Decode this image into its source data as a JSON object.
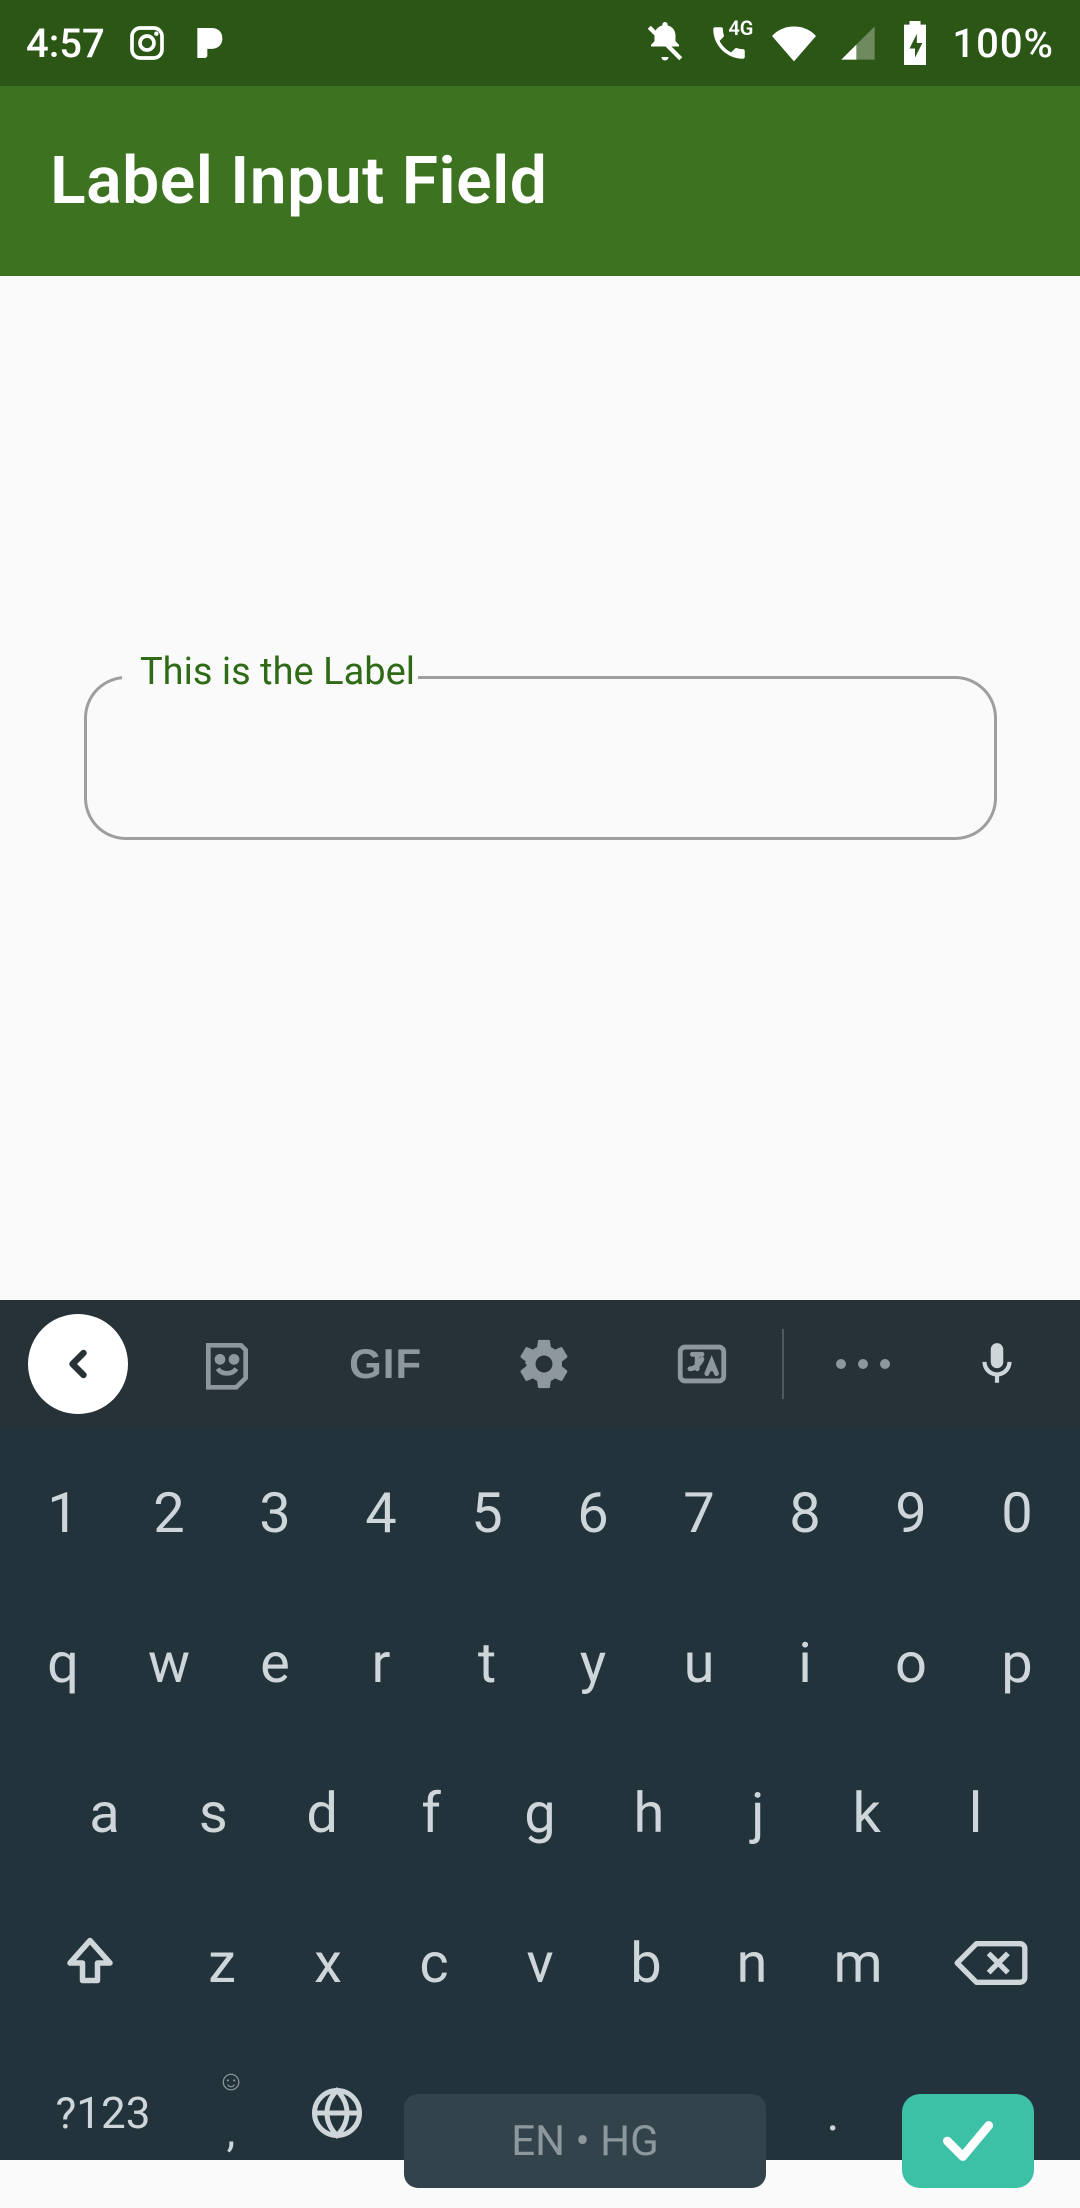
{
  "status": {
    "time": "4:57",
    "battery_pct": "100%",
    "phone_tag": "4G"
  },
  "appbar": {
    "title": "Label Input Field"
  },
  "field": {
    "label": "This is the Label",
    "value": ""
  },
  "keyboard": {
    "toolbar": {
      "gif": "GIF"
    },
    "rows": {
      "numbers": [
        "1",
        "2",
        "3",
        "4",
        "5",
        "6",
        "7",
        "8",
        "9",
        "0"
      ],
      "top": [
        "q",
        "w",
        "e",
        "r",
        "t",
        "y",
        "u",
        "i",
        "o",
        "p"
      ],
      "home": [
        "a",
        "s",
        "d",
        "f",
        "g",
        "h",
        "j",
        "k",
        "l"
      ],
      "bottom": [
        "z",
        "x",
        "c",
        "v",
        "b",
        "n",
        "m"
      ]
    },
    "symbols_key": "?123",
    "comma_key": ",",
    "period_key": ".",
    "space_label": "EN • HG"
  }
}
